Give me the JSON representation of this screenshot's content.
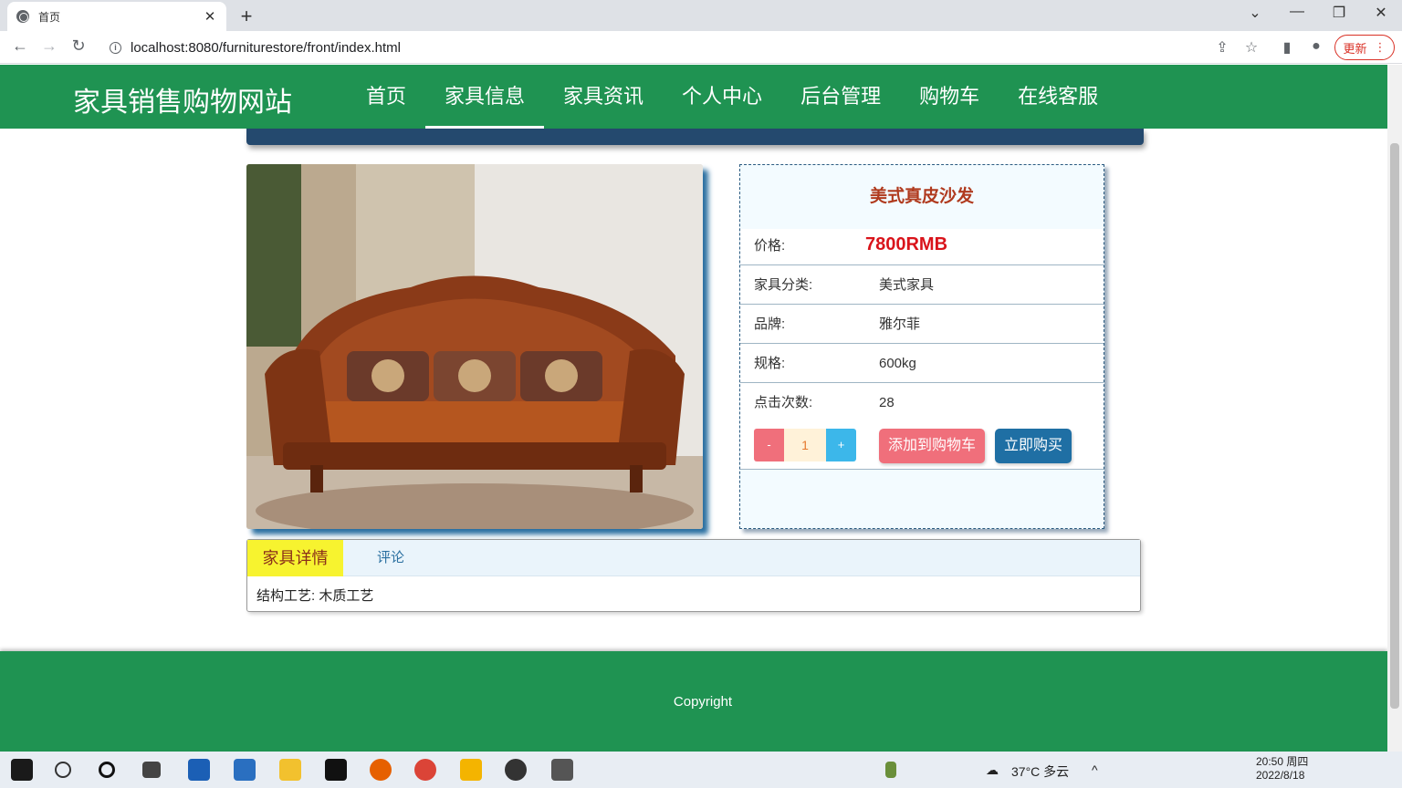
{
  "browser": {
    "tab_title": "首页",
    "url": "localhost:8080/furniturestore/front/index.html",
    "update_label": "更新"
  },
  "site": {
    "title": "家具销售购物网站",
    "nav": [
      "首页",
      "家具信息",
      "家具资讯",
      "个人中心",
      "后台管理",
      "购物车",
      "在线客服"
    ],
    "active_nav": "家具信息"
  },
  "product": {
    "name": "美式真皮沙发",
    "price_label": "价格:",
    "price": "7800RMB",
    "rows": [
      {
        "label": "家具分类:",
        "value": "美式家具"
      },
      {
        "label": "品牌:",
        "value": "雅尔菲"
      },
      {
        "label": "规格:",
        "value": "600kg"
      },
      {
        "label": "点击次数:",
        "value": "28"
      }
    ],
    "qty_minus": "-",
    "qty_value": "1",
    "qty_plus": "+",
    "add_to_cart": "添加到购物车",
    "buy_now": "立即购买"
  },
  "details": {
    "tab_detail": "家具详情",
    "tab_comments": "评论",
    "text": "结构工艺: 木质工艺"
  },
  "footer": {
    "text": "Copyright"
  },
  "taskbar": {
    "weather": "37°C 多云",
    "time": "20:50 周四",
    "date": "2022/8/18"
  },
  "colors": {
    "brand_green": "#1f9352",
    "price_red": "#d9141b",
    "product_name": "#b03a1e",
    "add_cart": "#f06f7b",
    "buy_now": "#1f6fa4"
  }
}
